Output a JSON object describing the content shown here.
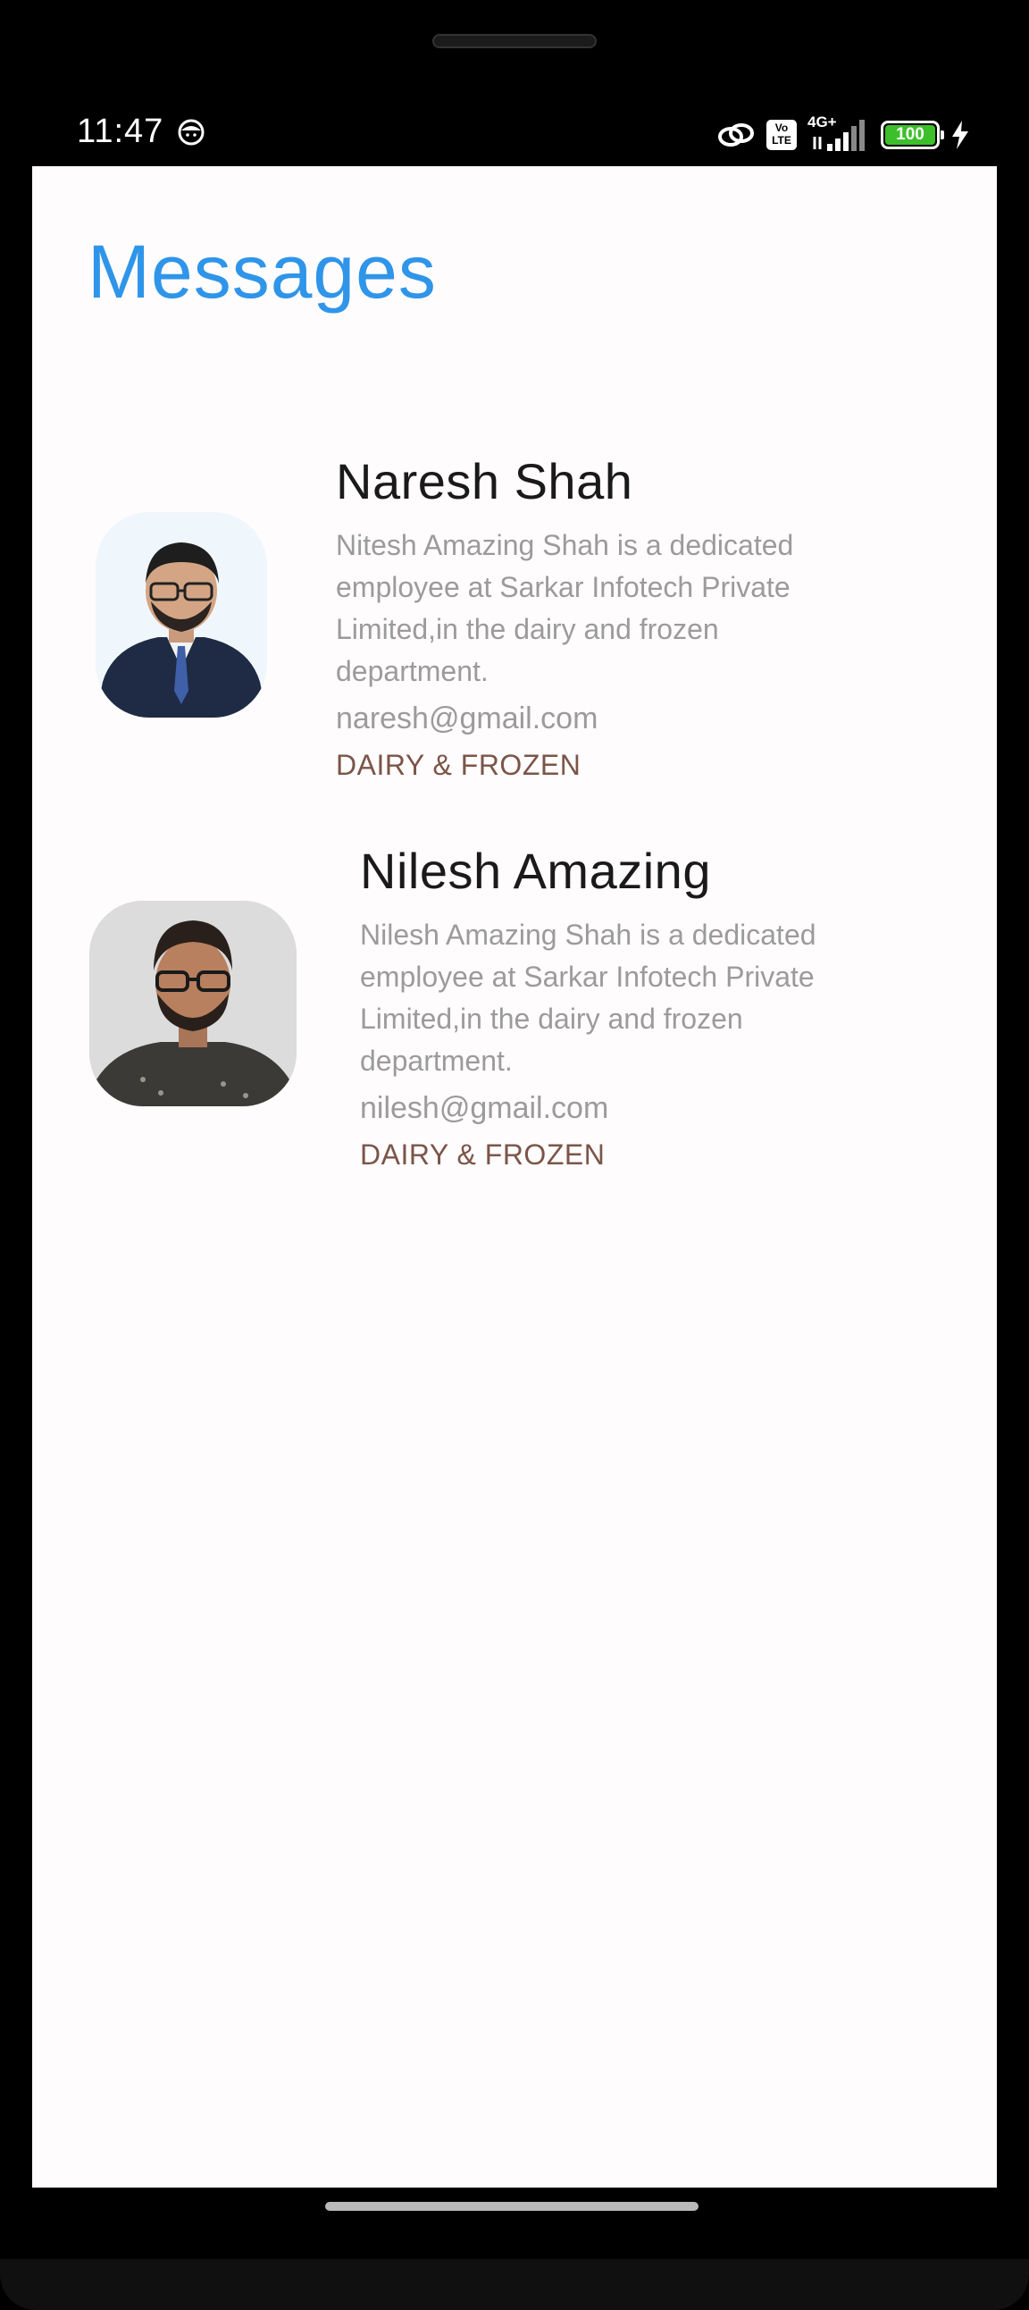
{
  "status": {
    "time": "11:47",
    "network": "4G+",
    "volte": "Vo LTE",
    "battery": "100"
  },
  "page": {
    "title": "Messages"
  },
  "contacts": [
    {
      "name": "Naresh Shah",
      "description": "Nitesh Amazing Shah is a dedicated employee at Sarkar Infotech Private Limited,in the dairy and frozen department.",
      "email": "naresh@gmail.com",
      "department": "DAIRY & FROZEN"
    },
    {
      "name": "Nilesh Amazing",
      "description": "Nilesh Amazing Shah is a dedicated employee at Sarkar Infotech Private Limited,in the dairy and frozen department.",
      "email": "nilesh@gmail.com",
      "department": "DAIRY & FROZEN"
    }
  ],
  "colors": {
    "title": "#2f95e9",
    "department": "#7b5548",
    "battery_fill": "#3dbf2b",
    "background": "#fffcfe"
  }
}
